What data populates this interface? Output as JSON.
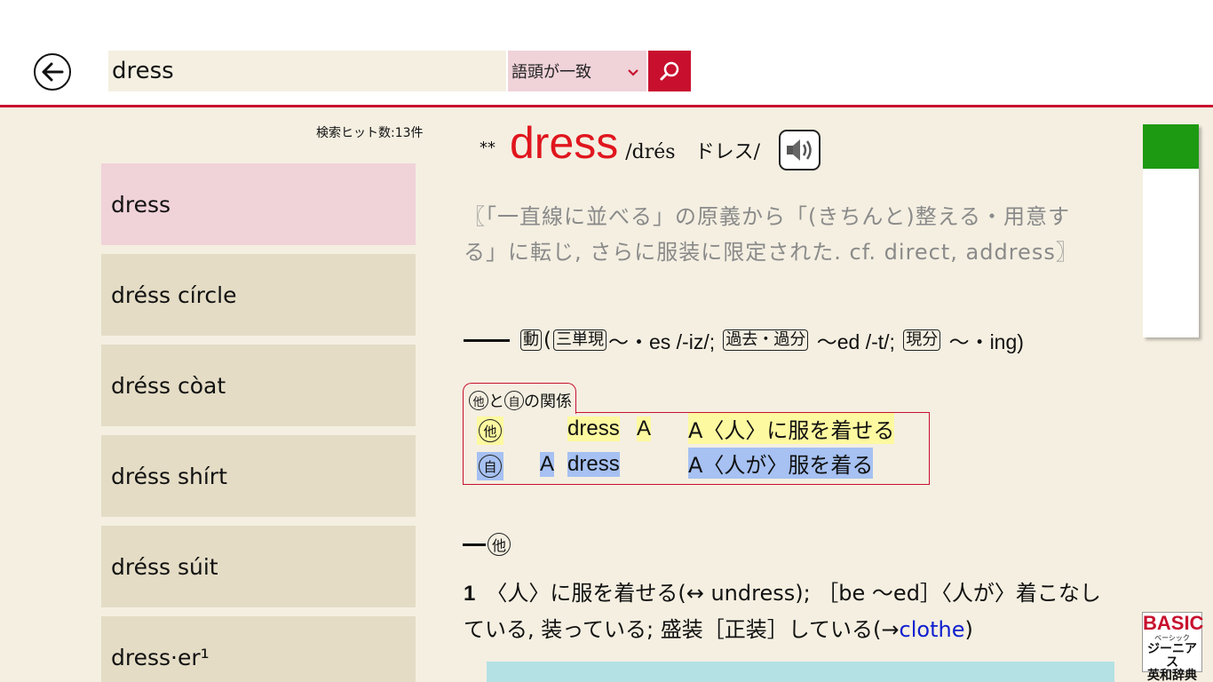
{
  "search": {
    "query": "dress",
    "mode": "語頭が一致"
  },
  "results": {
    "hit_count": "検索ヒット数:13件",
    "items": [
      "dress",
      "dréss círcle",
      "dréss còat",
      "dréss shírt",
      "dréss súit",
      "dress·er¹"
    ]
  },
  "entry": {
    "stars": "**",
    "headword": "dress",
    "pron": "/drés　ドレス/",
    "etymology": "〖「一直線に並べる」の原義から「(きちんと)整える・用意する」に転じ, さらに服装に限定された. cf. direct, address〗",
    "conj": {
      "pos_box": "動",
      "open": "(",
      "box1": "三単現",
      "form1": "～・es /-iz/;",
      "box2": "過去・過分",
      "form2": "～ed /-t/;",
      "box3": "現分",
      "form3": "～・ing)"
    },
    "relation": {
      "title_a": "他",
      "title_mid": "と",
      "title_b": "自",
      "title_end": "の関係",
      "row1": {
        "mark": "他",
        "verb": "dress",
        "obj": "A",
        "meaning": "A〈人〉に服を着せる"
      },
      "row2": {
        "mark": "自",
        "subj": "A",
        "verb": "dress",
        "meaning": "A〈人が〉服を着る"
      }
    },
    "pos_label": "他",
    "sense": {
      "num": "1",
      "text": "〈人〉に服を着せる(↔ undress); ［be ～ed］〈人が〉着こなしている, 装っている; 盛装［正装］している(→",
      "link": "clothe",
      "close": ")"
    }
  },
  "logo": {
    "basic": "BASIC",
    "reading": "ベーシック",
    "title1": "ジーニアス",
    "title2": "英和辞典"
  },
  "colors": {
    "accent": "#c8102e",
    "headword": "#e0161e",
    "link": "#1020d0",
    "selected": "#f0d2d9",
    "index_green": "#1e9a12"
  }
}
